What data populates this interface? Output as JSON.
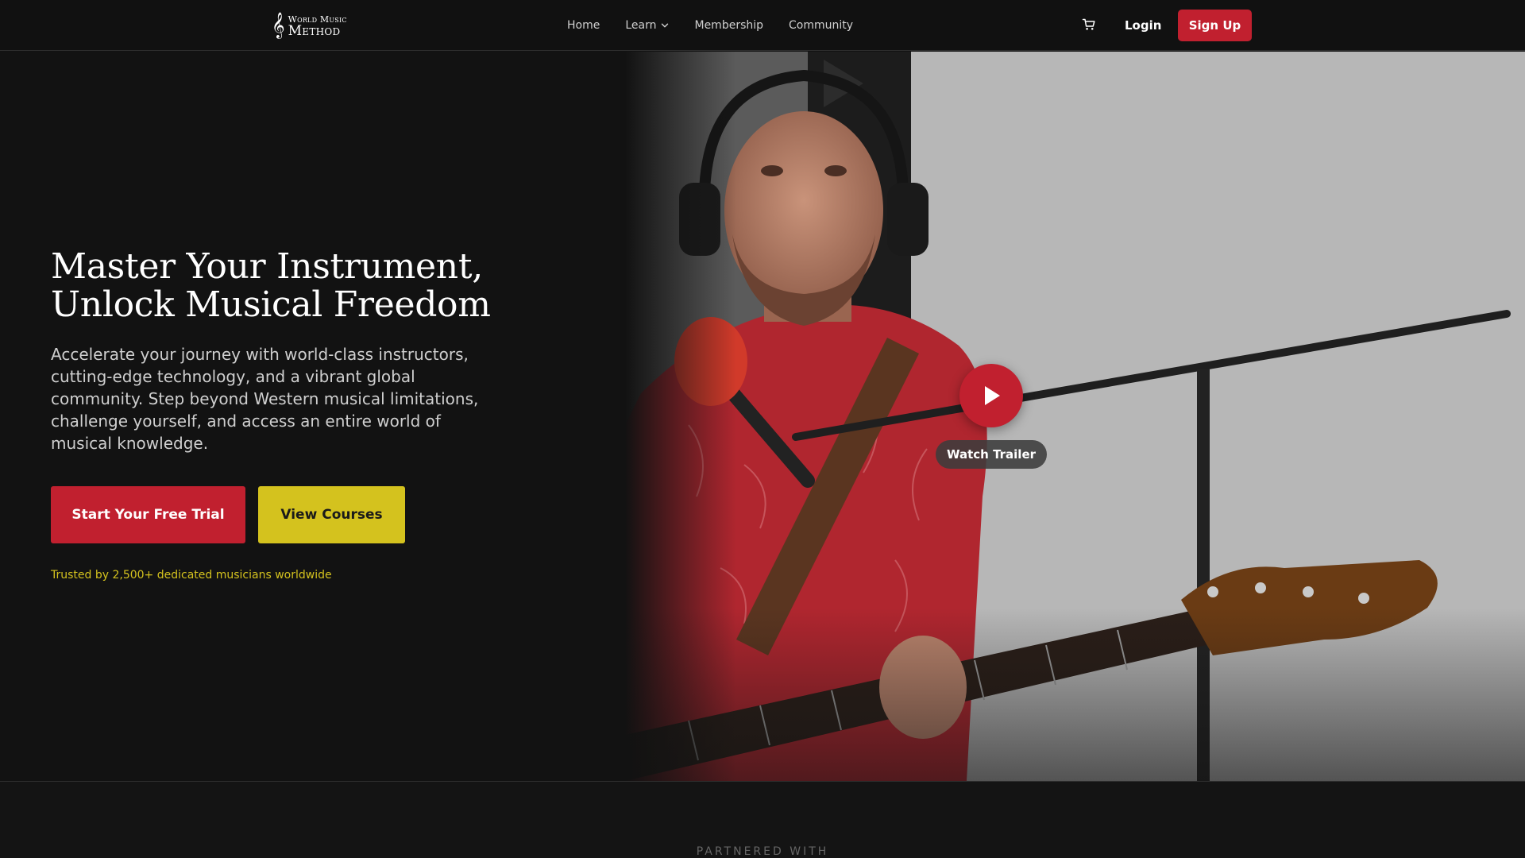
{
  "header": {
    "logo": {
      "line1": "World Music",
      "line2": "Method",
      "glyph": "𝄞"
    },
    "nav": [
      {
        "label": "Home"
      },
      {
        "label": "Learn"
      },
      {
        "label": "Membership"
      },
      {
        "label": "Community"
      }
    ],
    "cart_icon": "cart-icon",
    "login_label": "Login",
    "signup_label": "Sign Up"
  },
  "hero": {
    "title_line1": "Master Your Instrument,",
    "title_line2": "Unlock Musical Freedom",
    "subtitle": "Accelerate your journey with world-class instructors, cutting-edge technology, and a vibrant global community. Step beyond Western musical limitations, challenge yourself, and access an entire world of musical knowledge.",
    "primary_button": "Start Your Free Trial",
    "secondary_button": "View Courses",
    "trusted_text": "Trusted by 2,500+ dedicated musicians worldwide",
    "video": {
      "play_icon": "play-icon",
      "watch_label": "Watch Trailer"
    }
  },
  "partners": {
    "title": "PARTNERED WITH"
  },
  "colors": {
    "accent_red": "#c1202f",
    "accent_yellow": "#d4c21e",
    "background": "#121212"
  }
}
